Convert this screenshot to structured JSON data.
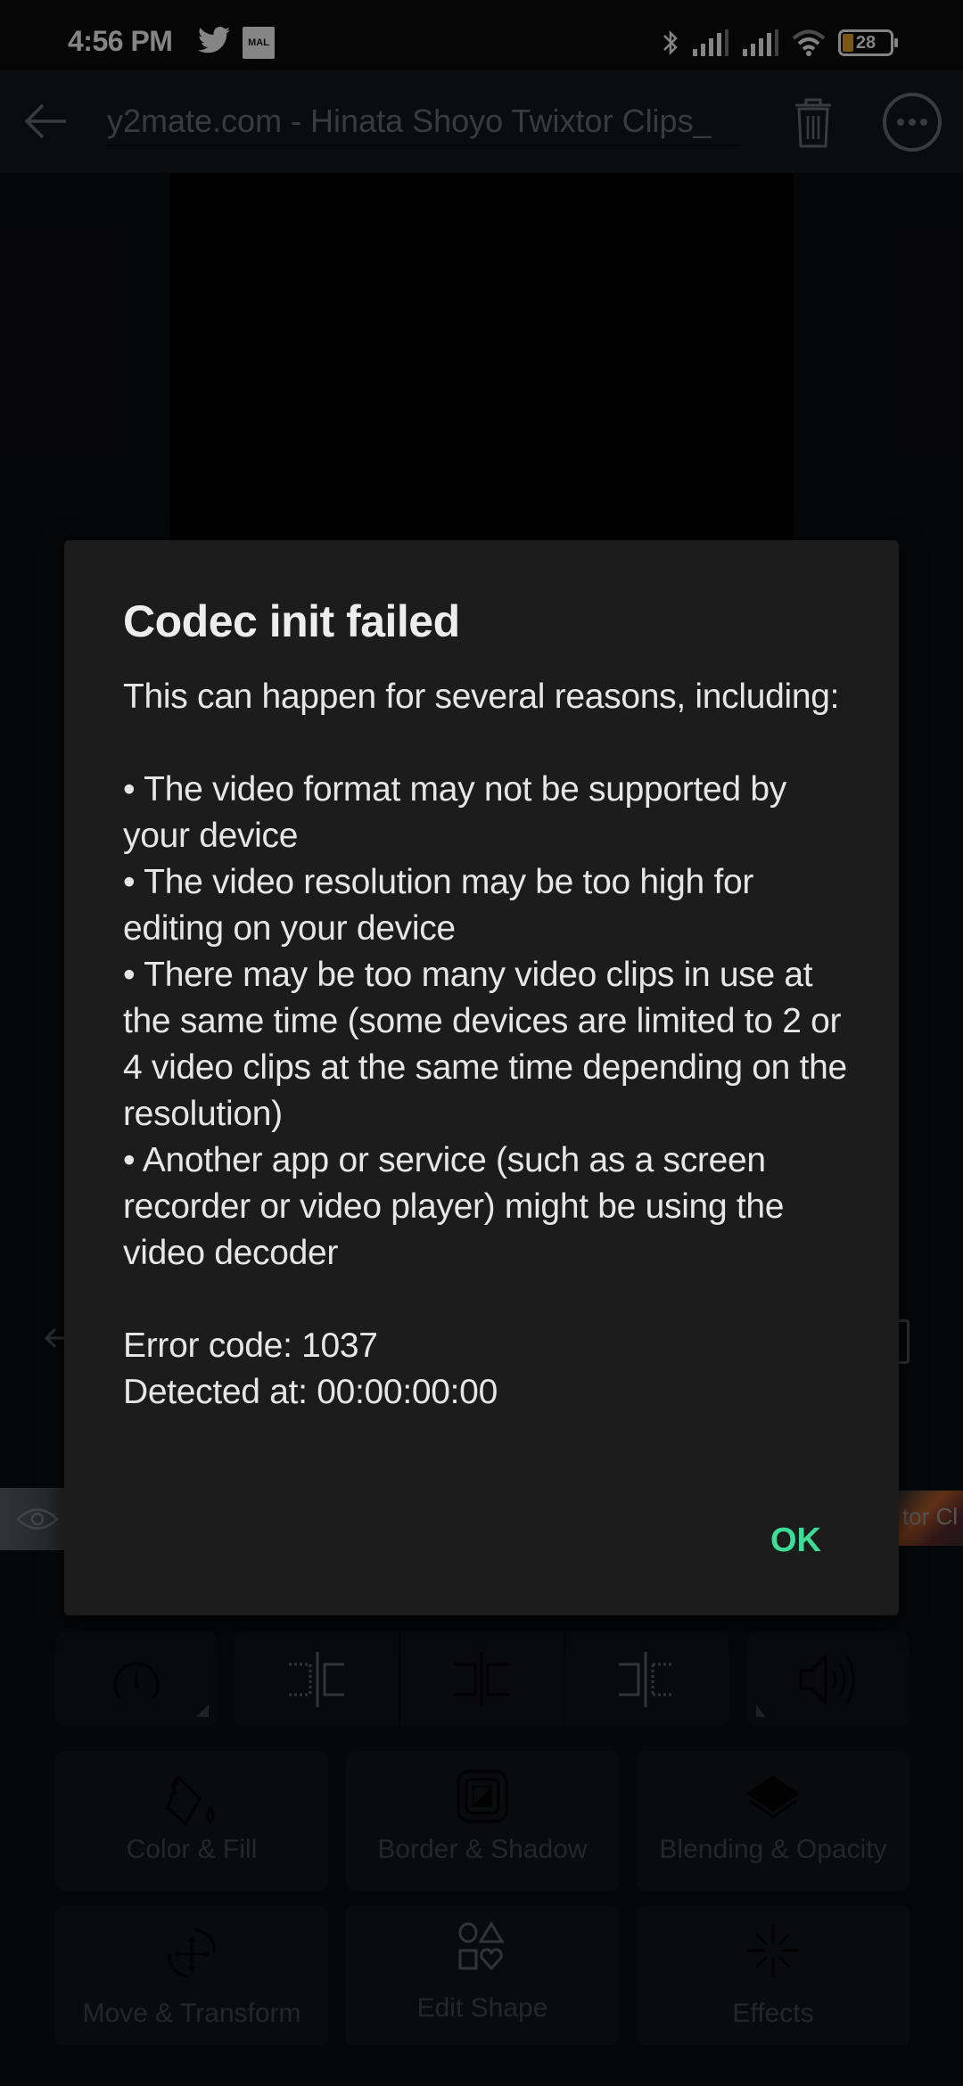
{
  "status_bar": {
    "time": "4:56 PM",
    "notification_icons": [
      "twitter-icon",
      "mal-icon"
    ],
    "mal_label": "MAL",
    "system_icons": [
      "bluetooth-icon",
      "signal-icon",
      "signal-icon",
      "wifi-icon",
      "battery-icon"
    ],
    "battery_level": "28",
    "battery_color": "#e0a030"
  },
  "app_bar": {
    "back_icon": "arrow-left-icon",
    "title": "y2mate.com - Hinata Shoyo Twixtor Clips_",
    "delete_icon": "trash-icon",
    "more_icon": "more-horizontal-icon"
  },
  "timeline": {
    "clip_right_label": "tor Cl"
  },
  "toolbar": {
    "tools": [
      {
        "name": "speed",
        "icon": "speedometer-icon"
      },
      {
        "name": "split-left",
        "icon": "trim-left-icon"
      },
      {
        "name": "split",
        "icon": "split-icon"
      },
      {
        "name": "split-right",
        "icon": "trim-right-icon"
      },
      {
        "name": "volume",
        "icon": "volume-icon"
      }
    ],
    "cards": [
      {
        "label": "Color & Fill",
        "icon": "paint-bucket-icon"
      },
      {
        "label": "Border & Shadow",
        "icon": "border-shadow-icon"
      },
      {
        "label": "Blending & Opacity",
        "icon": "layers-icon"
      },
      {
        "label": "Move & Transform",
        "icon": "move-rotate-icon"
      },
      {
        "label": "Edit Shape",
        "icon": "shapes-icon"
      },
      {
        "label": "Effects",
        "icon": "sparkle-icon"
      }
    ]
  },
  "dialog": {
    "title": "Codec init failed",
    "intro": "This can happen for several reasons, including:",
    "reasons": [
      "• The video format may not be supported by your device",
      "• The video resolution may be too high for editing on your device",
      "• There may be too many video clips in use at the same time (some devices are limited to 2 or 4 video clips at the same time depending on the resolution)",
      "• Another app or service (such as a screen recorder or video player) might be using the video decoder"
    ],
    "error_code": "Error code: 1037",
    "detected_at": "Detected at: 00:00:00:00",
    "ok_label": "OK",
    "accent_color": "#3ddc97"
  }
}
